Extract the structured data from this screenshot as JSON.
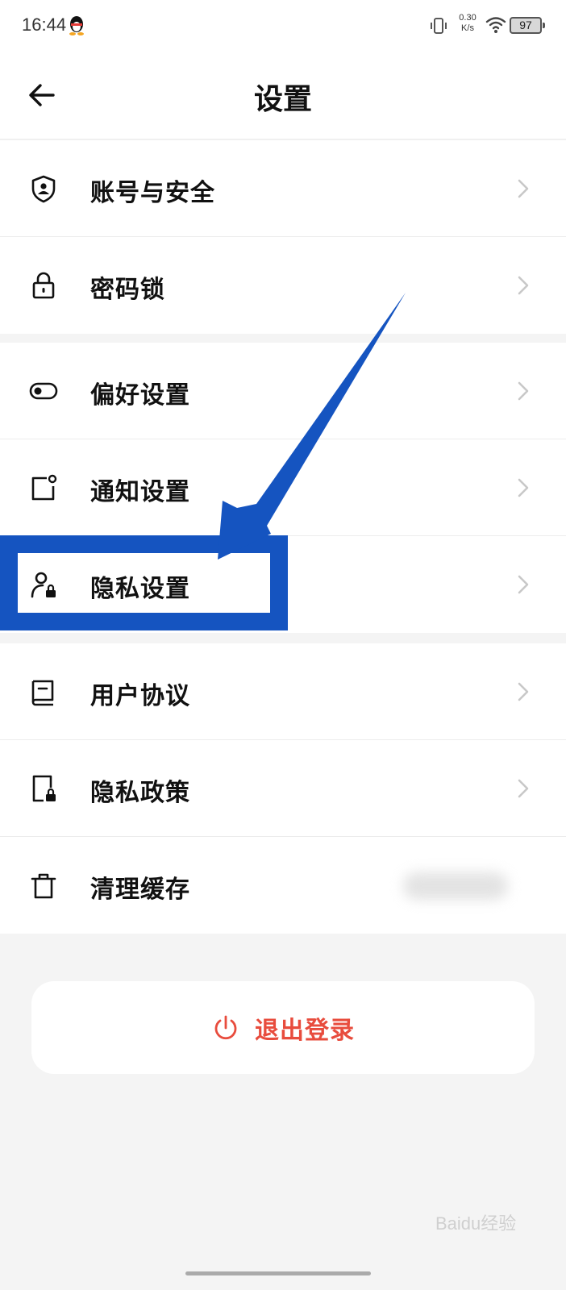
{
  "status_bar": {
    "time": "16:44",
    "net_speed_value": "0.30",
    "net_speed_unit": "K/s",
    "battery": "97"
  },
  "header": {
    "title": "设置"
  },
  "groups": [
    {
      "items": [
        {
          "label": "账号与安全",
          "icon": "shield-user-icon"
        },
        {
          "label": "密码锁",
          "icon": "lock-icon"
        }
      ]
    },
    {
      "items": [
        {
          "label": "偏好设置",
          "icon": "toggle-icon"
        },
        {
          "label": "通知设置",
          "icon": "notification-icon"
        },
        {
          "label": "隐私设置",
          "icon": "user-lock-icon"
        }
      ]
    },
    {
      "items": [
        {
          "label": "用户协议",
          "icon": "book-icon"
        },
        {
          "label": "隐私政策",
          "icon": "document-lock-icon"
        },
        {
          "label": "清理缓存",
          "icon": "trash-icon"
        }
      ]
    }
  ],
  "logout": {
    "label": "退出登录",
    "color": "#e84c3d"
  },
  "annotation": {
    "color": "#1554c0"
  },
  "watermark": "Baidu经验"
}
